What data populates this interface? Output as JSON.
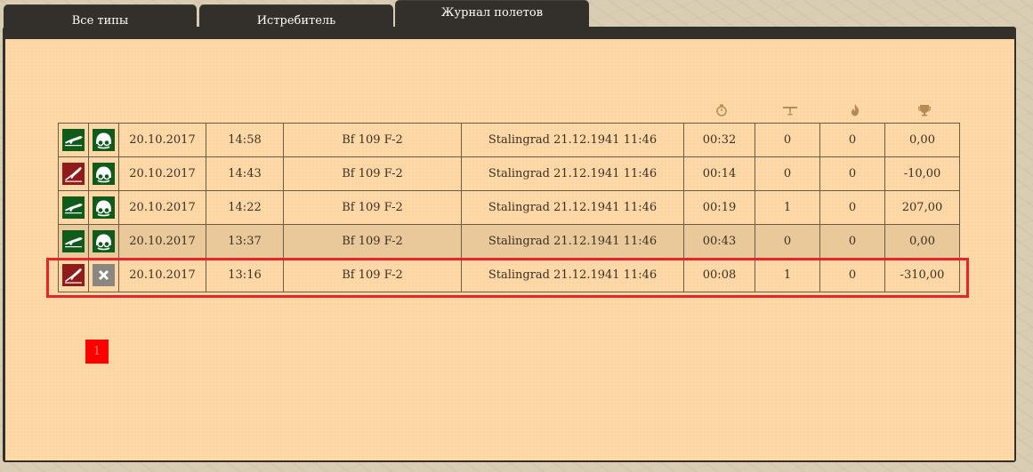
{
  "tabs": [
    {
      "label": "Все типы",
      "active": false
    },
    {
      "label": "Истребитель",
      "active": false
    },
    {
      "label": "Журнал полетов",
      "active": true
    }
  ],
  "columns": {
    "duration_icon": "stopwatch-icon",
    "kills_icon": "plane-icon",
    "ground_icon": "fire-icon",
    "score_icon": "trophy-icon"
  },
  "rows": [
    {
      "outcome": "landed",
      "status": "alive",
      "date": "20.10.2017",
      "time": "14:58",
      "aircraft": "Bf 109 F-2",
      "mission": "Stalingrad 21.12.1941 11:46",
      "duration": "00:32",
      "kills": "0",
      "ground": "0",
      "score": "0,00"
    },
    {
      "outcome": "crashed",
      "status": "alive",
      "date": "20.10.2017",
      "time": "14:43",
      "aircraft": "Bf 109 F-2",
      "mission": "Stalingrad 21.12.1941 11:46",
      "duration": "00:14",
      "kills": "0",
      "ground": "0",
      "score": "-10,00"
    },
    {
      "outcome": "landed",
      "status": "alive",
      "date": "20.10.2017",
      "time": "14:22",
      "aircraft": "Bf 109 F-2",
      "mission": "Stalingrad 21.12.1941 11:46",
      "duration": "00:19",
      "kills": "1",
      "ground": "0",
      "score": "207,00"
    },
    {
      "outcome": "landed",
      "status": "alive",
      "date": "20.10.2017",
      "time": "13:37",
      "aircraft": "Bf 109 F-2",
      "mission": "Stalingrad 21.12.1941 11:46",
      "duration": "00:43",
      "kills": "0",
      "ground": "0",
      "score": "0,00"
    },
    {
      "outcome": "crashed",
      "status": "dead",
      "date": "20.10.2017",
      "time": "13:16",
      "aircraft": "Bf 109 F-2",
      "mission": "Stalingrad 21.12.1941 11:46",
      "duration": "00:08",
      "kills": "1",
      "ground": "0",
      "score": "-310,00"
    }
  ],
  "pagination": {
    "current": "1"
  },
  "colors": {
    "landed": "#0f5c1a",
    "crashed": "#8f1b1b",
    "dead": "#8a8680",
    "highlight": "#e8242b",
    "panel": "#fed9a7",
    "frame": "#33302b"
  }
}
